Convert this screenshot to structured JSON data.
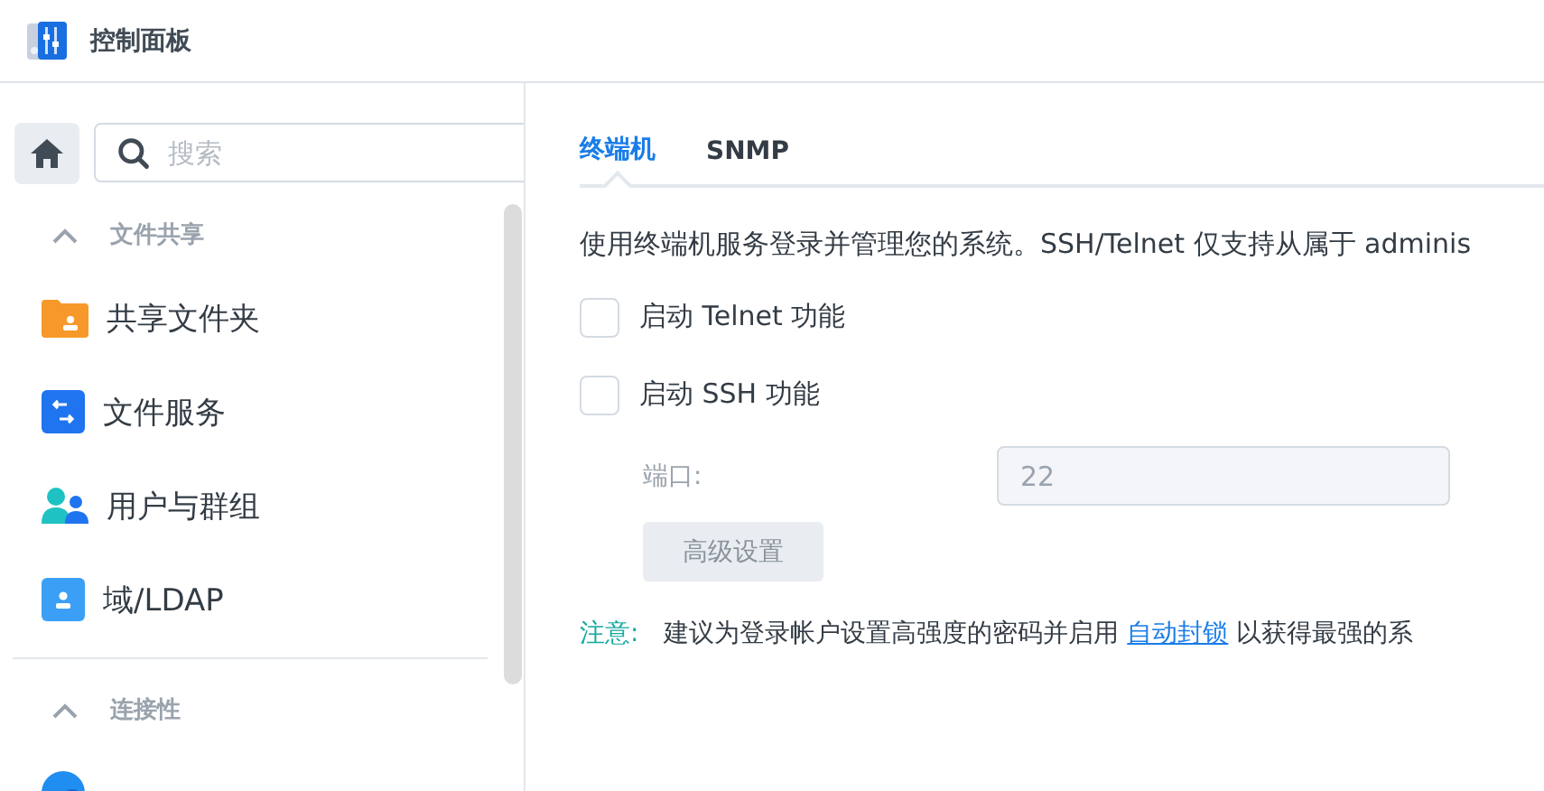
{
  "window": {
    "title": "控制面板"
  },
  "sidebar": {
    "search": {
      "placeholder": "搜索"
    },
    "sections": [
      {
        "title": "文件共享",
        "expanded": true,
        "items": [
          {
            "label": "共享文件夹",
            "kind": "folder"
          },
          {
            "label": "文件服务",
            "kind": "service"
          },
          {
            "label": "用户与群组",
            "kind": "users"
          },
          {
            "label": "域/LDAP",
            "kind": "directory"
          }
        ]
      },
      {
        "title": "连接性",
        "expanded": true,
        "items": [
          {
            "kind": "network"
          }
        ]
      }
    ]
  },
  "tabs": [
    {
      "label": "终端机",
      "selected": true
    },
    {
      "label": "SNMP",
      "selected": false
    }
  ],
  "description": "使用终端机服务登录并管理您的系统。SSH/Telnet 仅支持从属于 adminis",
  "options": [
    {
      "label": "启动 Telnet 功能",
      "checked": false
    },
    {
      "label": "启动 SSH 功能",
      "checked": false
    }
  ],
  "port": {
    "label": "端口:",
    "value": "22",
    "disabled": true
  },
  "advanced_button": {
    "label": "高级设置",
    "disabled": true
  },
  "note": {
    "label": "注意:",
    "before": "建议为登录帐户设置高强度的密码并启用",
    "link": "自动封锁",
    "after": "以获得最强的系"
  }
}
